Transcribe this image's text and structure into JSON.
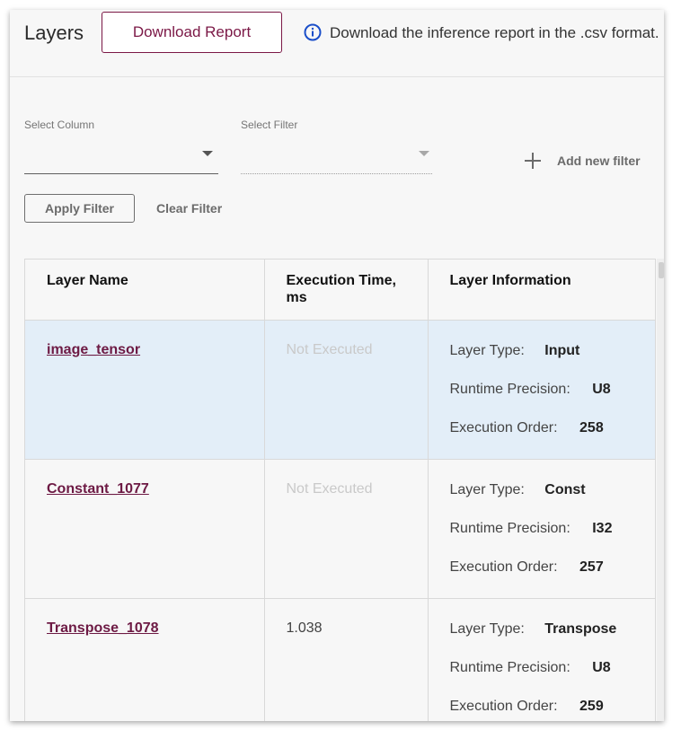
{
  "header": {
    "title": "Layers",
    "download_label": "Download Report",
    "info_text": "Download the inference report in the .csv format."
  },
  "filters": {
    "column_label": "Select Column",
    "column_value": "",
    "filter_label": "Select Filter",
    "filter_value": "",
    "add_label": "Add new filter",
    "apply_label": "Apply Filter",
    "clear_label": "Clear Filter"
  },
  "table": {
    "columns": [
      "Layer Name",
      "Execution Time, ms",
      "Layer Information"
    ],
    "info_labels": {
      "type": "Layer Type:",
      "precision": "Runtime Precision:",
      "order": "Execution Order:"
    },
    "rows": [
      {
        "name": "image_tensor",
        "exec": "Not Executed",
        "type": "Input",
        "precision": "U8",
        "order": "258"
      },
      {
        "name": "Constant_1077",
        "exec": "Not Executed",
        "type": "Const",
        "precision": "I32",
        "order": "257"
      },
      {
        "name": "Transpose_1078",
        "exec": "1.038",
        "type": "Transpose",
        "precision": "U8",
        "order": "259"
      }
    ]
  },
  "colors": {
    "accent": "#7b1846",
    "link": "#6d1a44",
    "info_icon": "#1a4ec9",
    "highlight_row": "#e3eef8"
  },
  "icons": {
    "info": "info-circle-icon",
    "add": "plus-icon",
    "dropdown": "caret-down-icon"
  }
}
